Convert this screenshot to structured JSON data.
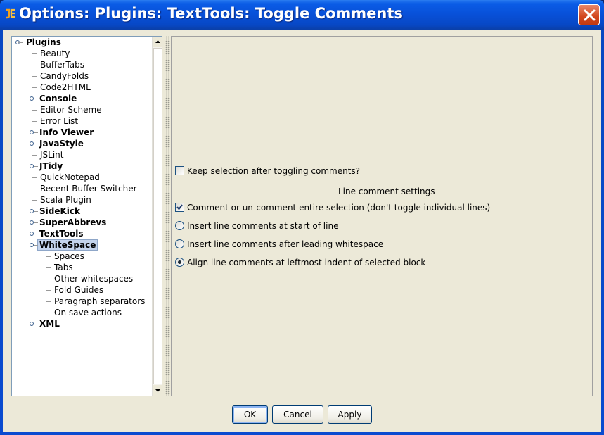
{
  "window": {
    "title": "Options: Plugins: TextTools: Toggle Comments"
  },
  "tree": {
    "root": "Plugins",
    "items": [
      {
        "label": "Beauty",
        "bold": false
      },
      {
        "label": "BufferTabs",
        "bold": false
      },
      {
        "label": "CandyFolds",
        "bold": false
      },
      {
        "label": "Code2HTML",
        "bold": false
      },
      {
        "label": "Console",
        "bold": true
      },
      {
        "label": "Editor Scheme",
        "bold": false
      },
      {
        "label": "Error List",
        "bold": false
      },
      {
        "label": "Info Viewer",
        "bold": true
      },
      {
        "label": "JavaStyle",
        "bold": true
      },
      {
        "label": "JSLint",
        "bold": false
      },
      {
        "label": "JTidy",
        "bold": true
      },
      {
        "label": "QuickNotepad",
        "bold": false
      },
      {
        "label": "Recent Buffer Switcher",
        "bold": false
      },
      {
        "label": "Scala Plugin",
        "bold": false
      },
      {
        "label": "SideKick",
        "bold": true
      },
      {
        "label": "SuperAbbrevs",
        "bold": true
      },
      {
        "label": "TextTools",
        "bold": true
      },
      {
        "label": "WhiteSpace",
        "bold": true,
        "selected": true
      }
    ],
    "whitespace_children": [
      "Spaces",
      "Tabs",
      "Other whitespaces",
      "Fold Guides",
      "Paragraph separators",
      "On save actions"
    ],
    "last_item": "XML"
  },
  "options": {
    "keep_selection": {
      "label": "Keep selection after toggling comments?",
      "checked": false
    },
    "group_title": "Line comment settings",
    "entire_selection": {
      "label": "Comment or un-comment entire selection (don't toggle individual lines)",
      "checked": true
    },
    "radios": [
      {
        "label": "Insert line comments at start of line",
        "selected": false
      },
      {
        "label": "Insert line comments after leading whitespace",
        "selected": false
      },
      {
        "label": "Align line comments at leftmost indent of selected block",
        "selected": true
      }
    ]
  },
  "buttons": {
    "ok": "OK",
    "cancel": "Cancel",
    "apply": "Apply"
  },
  "icons": {
    "app": "jedit-icon",
    "close": "close-icon"
  }
}
